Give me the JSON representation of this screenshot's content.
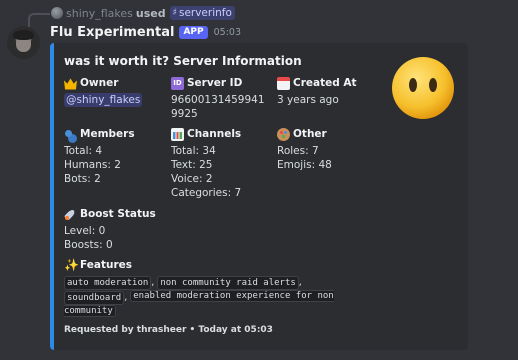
{
  "reply": {
    "username": "shiny_flakes",
    "used_text": "used",
    "command": "serverinfo"
  },
  "author": {
    "name": "Flu Experimental",
    "badge": "APP",
    "time": "05:03"
  },
  "embed": {
    "accent_color": "#2d8ae5",
    "title": "was it worth it? Server Information",
    "thumbnail_icon": "neutral-face-no-mouth-emoji",
    "fields": {
      "owner": {
        "name": "Owner",
        "icon": "crown-icon",
        "mention": "@shiny_flakes"
      },
      "server_id": {
        "name": "Server ID",
        "icon": "id-icon",
        "value": "966001314599419925"
      },
      "created_at": {
        "name": "Created At",
        "icon": "calendar-icon",
        "value": "3 years ago"
      },
      "members": {
        "name": "Members",
        "icon": "users-icon",
        "lines": [
          "Total: 4",
          "Humans: 2",
          "Bots: 2"
        ]
      },
      "channels": {
        "name": "Channels",
        "icon": "chart-icon",
        "lines": [
          "Total: 34",
          "Text: 25",
          "Voice: 2",
          "Categories: 7"
        ]
      },
      "other": {
        "name": "Other",
        "icon": "palette-icon",
        "lines": [
          "Roles: 7",
          "Emojis: 48"
        ]
      },
      "boost": {
        "name": "Boost Status",
        "icon": "rocket-icon",
        "lines": [
          "Level: 0",
          "Boosts: 0"
        ]
      },
      "features": {
        "name": "Features",
        "icon": "sparkles-icon",
        "items": [
          "auto moderation",
          "non community raid alerts",
          "soundboard",
          "enabled moderation experience for non community"
        ]
      }
    },
    "footer": "Requested by thrasheer • Today at 05:03"
  }
}
